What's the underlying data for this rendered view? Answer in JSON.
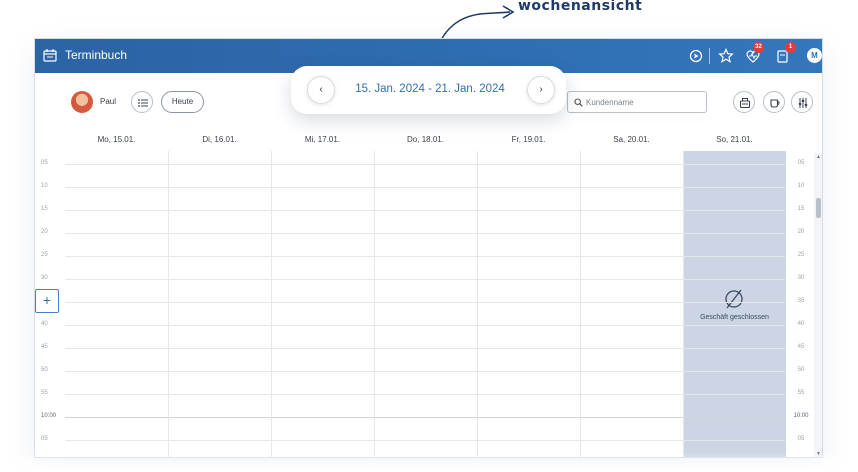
{
  "annotation": {
    "text": "wochenansicht"
  },
  "app": {
    "title": "Terminbuch",
    "icon": "calendar-icon"
  },
  "topbar": {
    "icons": [
      "play-circle-icon",
      "star-icon",
      "heart-pulse-icon",
      "document-icon"
    ],
    "heart_badge": "32",
    "doc_badge": "1",
    "user_initial": "M"
  },
  "staff": {
    "name": "Paul",
    "today_label": "Heute"
  },
  "navigator": {
    "range": "15. Jan. 2024 - 21. Jan. 2024",
    "prev": "‹",
    "next": "›"
  },
  "search": {
    "placeholder": "Kundenname",
    "value": ""
  },
  "days": [
    "Mo, 15.01.",
    "Di, 16.01.",
    "Mi, 17.01.",
    "Do, 18.01.",
    "Fr, 19.01.",
    "Sa, 20.01.",
    "So, 21.01."
  ],
  "closed_day": {
    "label": "Geschäft geschlossen",
    "symbol": "∅"
  },
  "timeline": [
    "05",
    "10",
    "15",
    "20",
    "25",
    "30",
    "35",
    "40",
    "45",
    "50",
    "55",
    "10:00",
    "05"
  ],
  "add_button": "+",
  "colors": {
    "topbar": "#2f6eb3",
    "accent": "#2f6eb3",
    "closed": "#cbd5e3",
    "badge": "#e23b3b"
  }
}
